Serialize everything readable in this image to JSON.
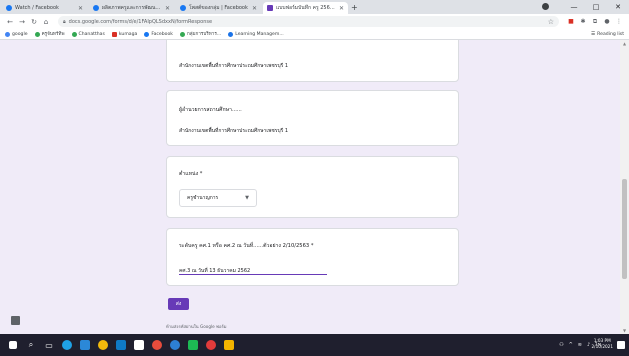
{
  "browser": {
    "tabs": [
      {
        "title": "Watch / Facebook",
        "fav_color": "#1877f2",
        "active": false
      },
      {
        "title": "ผลิตภาพครูและการพัฒนา | Fac...",
        "fav_color": "#1877f2",
        "active": false
      },
      {
        "title": "โพสต์ของกลุ่ม | Facebook",
        "fav_color": "#1877f2",
        "active": false
      },
      {
        "title": "แบบฟอร์มบันทึก ครู 2563 - Google...",
        "fav_color": "#673ab7",
        "active": true
      }
    ],
    "new_tab": "+",
    "window_controls": [
      "—",
      "□",
      "✕"
    ],
    "url": "docs.google.com/forms/d/e/1FAIpQLSdxxN/formResponse",
    "bookmarks": [
      {
        "label": "google",
        "color": "#4285f4"
      },
      {
        "label": "ครูจันทร์ทิพ",
        "color": "#34a853"
      },
      {
        "label": "Chanatthas",
        "color": "#34a853"
      },
      {
        "label": "kumaga",
        "color": "#d93025"
      },
      {
        "label": "Facebook",
        "color": "#1877f2"
      },
      {
        "label": "กลุ่มการบริหาร...",
        "color": "#34a853"
      },
      {
        "label": "Learning Managem...",
        "color": "#1a73e8"
      }
    ],
    "reading_list": "Reading list"
  },
  "form": {
    "card1": {
      "answer": "สำนักงานเขตพื้นที่การศึกษาประถมศึกษาเพชรบุรี 1"
    },
    "card2": {
      "question": "ผู้อำนวยการสถานศึกษา......",
      "answer": "สำนักงานเขตพื้นที่การศึกษาประถมศึกษาเพชรบุรี 1"
    },
    "card3": {
      "question": "ตำแหน่ง *",
      "dropdown_value": "ครูชำนาญการ"
    },
    "card4": {
      "question": "ระดับครู คศ.1 หรือ คศ.2 ณ วันที่......ตัวอย่าง 2/10/2563 *",
      "answer": "คศ.3 ณ วันที่ 13 ธันวาคม 2562"
    },
    "submit_label": "ส่ง",
    "footnote": "ห้ามส่งรหัสผ่านใน Google ฟอร์ม"
  },
  "taskbar": {
    "clock_time": "1:03 PM",
    "clock_date": "2/10/2021"
  },
  "colors": {
    "accent": "#673ab7",
    "page_bg": "#f0ebf8"
  }
}
